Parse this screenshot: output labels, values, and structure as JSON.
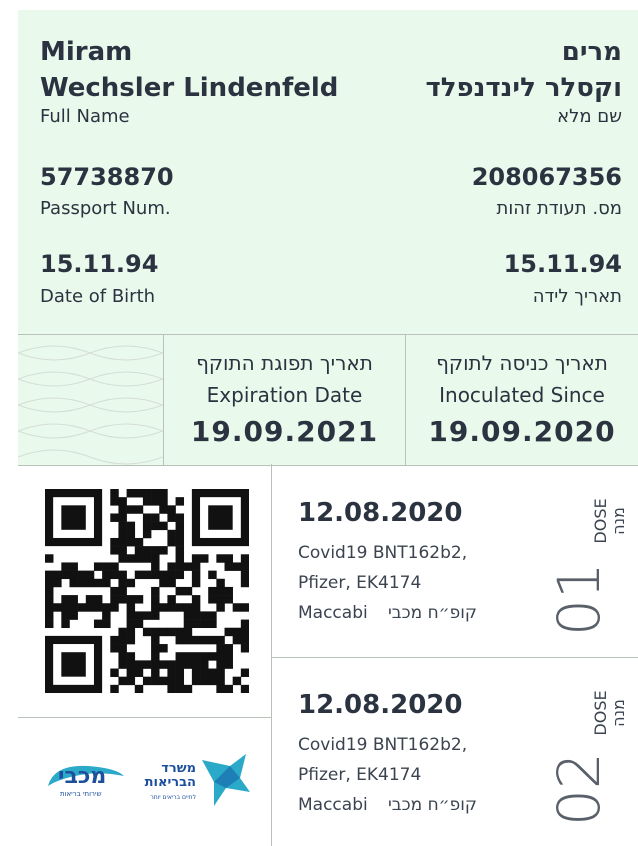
{
  "identity": {
    "name_en_first": "Miram",
    "name_en_last": "Wechsler Lindenfeld",
    "name_en_label": "Full Name",
    "name_he_first": "מרים",
    "name_he_last": "וקסלר לינדנפלד",
    "name_he_label": "שם מלא",
    "passport_num": "57738870",
    "passport_label": "Passport Num.",
    "id_num": "208067356",
    "id_label": "מס. תעודת זהות",
    "dob_en": "15.11.94",
    "dob_en_label": "Date of Birth",
    "dob_he": "15.11.94",
    "dob_he_label": "תאריך לידה"
  },
  "validity": {
    "expiration_he": "תאריך תפוגת התוקף",
    "expiration_en": "Expiration Date",
    "expiration_date": "19.09.2021",
    "inoculated_he": "תאריך כניסה לתוקף",
    "inoculated_en": "Inoculated Since",
    "inoculated_date": "19.09.2020"
  },
  "doses": [
    {
      "date": "12.08.2020",
      "vaccine": "Covid19 BNT162b2,",
      "maker": "Pfizer,  EK4174",
      "provider_en": "Maccabi",
      "provider_he": "קופ״ח מכבי",
      "number": "01",
      "dose_en": "DOSE",
      "dose_he": "מנה"
    },
    {
      "date": "12.08.2020",
      "vaccine": "Covid19 BNT162b2,",
      "maker": "Pfizer,  EK4174",
      "provider_en": "Maccabi",
      "provider_he": "קופ״ח מכבי",
      "number": "02",
      "dose_en": "DOSE",
      "dose_he": "מנה"
    }
  ],
  "logos": {
    "maccabi_text": "מכבי",
    "maccabi_sub": "שירותי בריאות",
    "moh_line1": "משרד",
    "moh_line2": "הבריאות",
    "moh_sub": "לחיים בריאים יותר"
  },
  "colors": {
    "panel_bg": "#e9f9ec",
    "text": "#2b3340",
    "maccabi_blue": "#1d4f9c",
    "moh_teal": "#2aa9c9"
  }
}
